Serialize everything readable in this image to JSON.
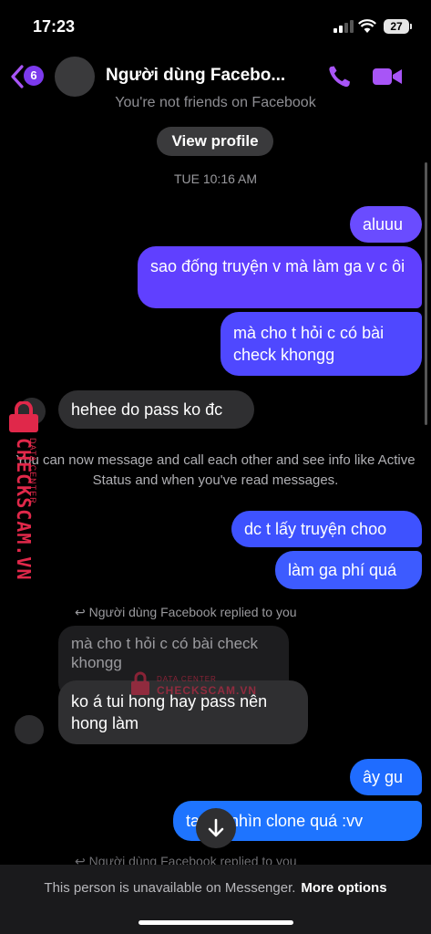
{
  "status_bar": {
    "time": "17:23",
    "battery": "27"
  },
  "header": {
    "back_badge": "6",
    "title": "Người dùng Facebo...",
    "subtitle": "You're not friends on Facebook",
    "view_profile": "View profile"
  },
  "timestamp": "TUE 10:16 AM",
  "messages": [
    {
      "side": "out",
      "text": "aluuu"
    },
    {
      "side": "out",
      "text": "sao đống truyện v mà làm ga v c ôi"
    },
    {
      "side": "out",
      "text": "mà cho t hỏi c có bài check khongg"
    },
    {
      "side": "in",
      "text": "hehee do pass ko đc"
    },
    {
      "side": "out",
      "text": "dc t lấy truyện choo"
    },
    {
      "side": "out",
      "text": "làm ga phí quá"
    },
    {
      "side": "in",
      "text": "ko á tui hong hay pass nên hong làm"
    },
    {
      "side": "out",
      "text": "ây gu"
    },
    {
      "side": "out",
      "text": "ta    c c nhìn clone quá :vv"
    }
  ],
  "system_message": "You can now message and call each other and see info like Active Status and when you've read messages.",
  "reply_note": "Người dùng Facebook replied to you",
  "quoted_text": "mà cho t hỏi c có bài check khongg",
  "reply_note_2": "Người dùng Facebook replied to you",
  "footer": {
    "unavailable": "This person is unavailable on Messenger.",
    "more_options": "More options"
  },
  "watermark": {
    "brand": "CHECKSCAM.VN",
    "sub": "DATA CENTER"
  },
  "colors": {
    "accent": "#a855f7",
    "background": "#000000",
    "incoming_bubble": "#2f2f31"
  }
}
